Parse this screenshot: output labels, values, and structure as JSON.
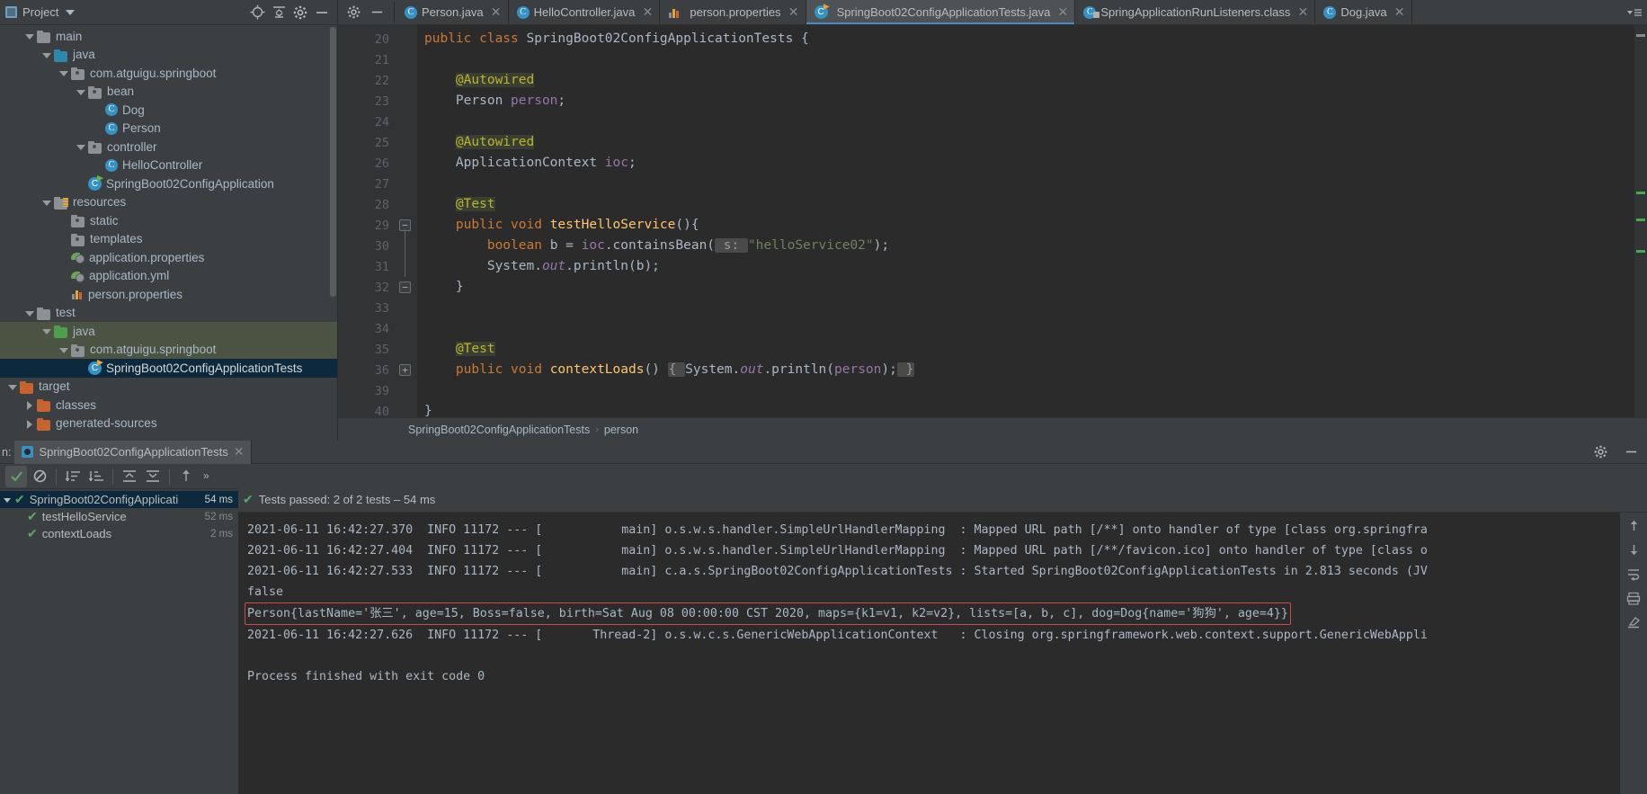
{
  "project_panel": {
    "title": "Project",
    "buttons": [
      "locate-icon",
      "collapse-all-icon",
      "settings-icon",
      "hide-icon"
    ],
    "tree": [
      {
        "label": "main",
        "indent": 1,
        "arrow": "open",
        "icon": "folder-grey"
      },
      {
        "label": "java",
        "indent": 2,
        "arrow": "open",
        "icon": "folder-blue"
      },
      {
        "label": "com.atguigu.springboot",
        "indent": 3,
        "arrow": "open",
        "icon": "package"
      },
      {
        "label": "bean",
        "indent": 4,
        "arrow": "open",
        "icon": "package"
      },
      {
        "label": "Dog",
        "indent": 5,
        "arrow": "none",
        "icon": "class"
      },
      {
        "label": "Person",
        "indent": 5,
        "arrow": "none",
        "icon": "class"
      },
      {
        "label": "controller",
        "indent": 4,
        "arrow": "open",
        "icon": "package"
      },
      {
        "label": "HelloController",
        "indent": 5,
        "arrow": "none",
        "icon": "class"
      },
      {
        "label": "SpringBoot02ConfigApplication",
        "indent": 4,
        "arrow": "none",
        "icon": "spring-class"
      },
      {
        "label": "resources",
        "indent": 2,
        "arrow": "open",
        "icon": "folder-resources"
      },
      {
        "label": "static",
        "indent": 3,
        "arrow": "none",
        "icon": "package"
      },
      {
        "label": "templates",
        "indent": 3,
        "arrow": "none",
        "icon": "package"
      },
      {
        "label": "application.properties",
        "indent": 3,
        "arrow": "none",
        "icon": "leaf-green"
      },
      {
        "label": "application.yml",
        "indent": 3,
        "arrow": "none",
        "icon": "leaf-green"
      },
      {
        "label": "person.properties",
        "indent": 3,
        "arrow": "none",
        "icon": "properties"
      },
      {
        "label": "test",
        "indent": 1,
        "arrow": "open",
        "icon": "folder-grey"
      },
      {
        "label": "java",
        "indent": 2,
        "arrow": "open",
        "icon": "folder-green",
        "state": "highlight-green"
      },
      {
        "label": "com.atguigu.springboot",
        "indent": 3,
        "arrow": "open",
        "icon": "package",
        "state": "highlight-green"
      },
      {
        "label": "SpringBoot02ConfigApplicationTests",
        "indent": 4,
        "arrow": "none",
        "icon": "spring-test-class",
        "state": "selected"
      },
      {
        "label": "target",
        "indent": 0,
        "arrow": "open",
        "icon": "folder-orange"
      },
      {
        "label": "classes",
        "indent": 1,
        "arrow": "closed",
        "icon": "folder-orange"
      },
      {
        "label": "generated-sources",
        "indent": 1,
        "arrow": "closed",
        "icon": "folder-orange"
      }
    ]
  },
  "tabs": [
    {
      "label": "Person.java",
      "icon": "java-class-icon",
      "active": false
    },
    {
      "label": "HelloController.java",
      "icon": "java-class-icon",
      "active": false
    },
    {
      "label": "person.properties",
      "icon": "properties-icon",
      "active": false
    },
    {
      "label": "SpringBoot02ConfigApplicationTests.java",
      "icon": "spring-test-icon",
      "active": true
    },
    {
      "label": "SpringApplicationRunListeners.class",
      "icon": "java-class-locked-icon",
      "active": false
    },
    {
      "label": "Dog.java",
      "icon": "java-class-icon",
      "active": false
    }
  ],
  "editor": {
    "lines": [
      {
        "num": "20",
        "gutter": "run-all",
        "text_html": "<span class=\"kw\">public class </span><span class=\"cls-nm\">SpringBoot02ConfigApplicationTests </span>{"
      },
      {
        "num": "21",
        "gutter": "",
        "text_html": ""
      },
      {
        "num": "22",
        "gutter": "",
        "text_html": "    <span class=\"ann\">@Autowired</span>"
      },
      {
        "num": "23",
        "gutter": "bean",
        "text_html": "    <span class=\"cls-nm\">Person </span><span class=\"fld\">person</span>;"
      },
      {
        "num": "24",
        "gutter": "",
        "text_html": ""
      },
      {
        "num": "25",
        "gutter": "",
        "text_html": "    <span class=\"ann\">@Autowired</span>"
      },
      {
        "num": "26",
        "gutter": "bean",
        "text_html": "    <span class=\"cls-nm\">ApplicationContext </span><span class=\"fld\">ioc</span>;"
      },
      {
        "num": "27",
        "gutter": "",
        "text_html": ""
      },
      {
        "num": "28",
        "gutter": "",
        "text_html": "    <span class=\"ann\">@Test</span>"
      },
      {
        "num": "29",
        "gutter": "run",
        "fold": "start",
        "text_html": "    <span class=\"kw\">public void </span><span class=\"mtd\">testHelloService</span>(){"
      },
      {
        "num": "30",
        "gutter": "",
        "fold": "mid",
        "text_html": "        <span class=\"kw\">boolean </span>b = <span class=\"fld\">ioc</span>.containsBean(<span class=\"hint\"> s: </span><span class=\"str\">\"helloService02\"</span>);"
      },
      {
        "num": "31",
        "gutter": "",
        "fold": "mid",
        "text_html": "        System.<span class=\"stat\">out</span>.println(b);"
      },
      {
        "num": "32",
        "gutter": "",
        "fold": "end",
        "text_html": "    }"
      },
      {
        "num": "33",
        "gutter": "",
        "text_html": ""
      },
      {
        "num": "34",
        "gutter": "",
        "text_html": ""
      },
      {
        "num": "35",
        "gutter": "",
        "text_html": "    <span class=\"ann\">@Test</span>"
      },
      {
        "num": "36",
        "gutter": "run",
        "fold": "plus",
        "text_html": "    <span class=\"kw\">public void </span><span class=\"mtd\">contextLoads</span>() <span class=\"hint\">{ </span>System.<span class=\"stat\">out</span>.println(<span class=\"fld\">person</span>);<span class=\"hint\"> }</span>"
      },
      {
        "num": "39",
        "gutter": "",
        "text_html": ""
      },
      {
        "num": "40",
        "gutter": "",
        "text_html": "}"
      }
    ],
    "breadcrumb": [
      "SpringBoot02ConfigApplicationTests",
      "person"
    ]
  },
  "run_panel": {
    "side_label": "n:",
    "tab_label": "SpringBoot02ConfigApplicationTests",
    "status_text": "Tests passed: 2 of 2 tests – 54 ms",
    "tools": [
      "rerun-icon",
      "stop-icon",
      "sort-alpha-icon",
      "sort-duration-icon",
      "expand-all-icon",
      "collapse-all-icon",
      "up-arrow-icon",
      "more-icon"
    ],
    "test_tree": [
      {
        "label": "SpringBoot02ConfigApplicati",
        "time": "54 ms",
        "indent": 0,
        "arrow": true,
        "state": "selected"
      },
      {
        "label": "testHelloService",
        "time": "52 ms",
        "indent": 1,
        "arrow": false,
        "state": ""
      },
      {
        "label": "contextLoads",
        "time": "2 ms",
        "indent": 1,
        "arrow": false,
        "state": ""
      }
    ],
    "console_lines": [
      {
        "text": "2021-06-11 16:42:27.370  INFO 11172 --- [           main] o.s.w.s.handler.SimpleUrlHandlerMapping  : Mapped URL path [/**] onto handler of type [class org.springfra",
        "highlight": false
      },
      {
        "text": "2021-06-11 16:42:27.404  INFO 11172 --- [           main] o.s.w.s.handler.SimpleUrlHandlerMapping  : Mapped URL path [/**/favicon.ico] onto handler of type [class o",
        "highlight": false
      },
      {
        "text": "2021-06-11 16:42:27.533  INFO 11172 --- [           main] c.a.s.SpringBoot02ConfigApplicationTests : Started SpringBoot02ConfigApplicationTests in 2.813 seconds (JV",
        "highlight": false
      },
      {
        "text": "false",
        "highlight": false
      },
      {
        "text": "Person{lastName='张三', age=15, Boss=false, birth=Sat Aug 08 00:00:00 CST 2020, maps={k1=v1, k2=v2}, lists=[a, b, c], dog=Dog{name='狗狗', age=4}}",
        "highlight": true
      },
      {
        "text": "2021-06-11 16:42:27.626  INFO 11172 --- [       Thread-2] o.s.w.c.s.GenericWebApplicationContext   : Closing org.springframework.web.context.support.GenericWebAppli",
        "highlight": false
      },
      {
        "text": "",
        "highlight": false
      },
      {
        "text": "Process finished with exit code 0",
        "highlight": false
      }
    ],
    "console_side_buttons": [
      "scroll-up-icon",
      "scroll-down-icon",
      "soft-wrap-icon",
      "print-icon",
      "clear-icon"
    ],
    "settings_icon": "gear-icon",
    "minimize_icon": "minimize-icon"
  },
  "colors": {
    "accent_blue": "#4a88c7",
    "selection_blue": "#0d293e",
    "selection_green": "#4b5343",
    "highlight_red": "#cc4b4b",
    "pass_green": "#59a869",
    "editor_bg": "#2b2b2b",
    "panel_bg": "#3c3f41"
  }
}
